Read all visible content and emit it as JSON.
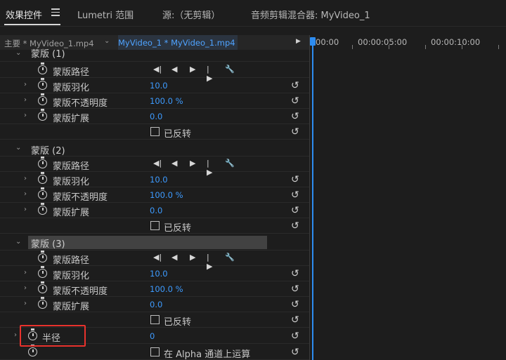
{
  "tabs": [
    {
      "label": "效果控件",
      "active": true
    },
    {
      "label": "Lumetri 范围",
      "active": false
    },
    {
      "label": "源:（无剪辑）",
      "active": false
    },
    {
      "label": "音频剪辑混合器: MyVideo_1",
      "active": false
    }
  ],
  "clip_header": {
    "master": "主要 * MyVideo_1.mp4",
    "sequence_clip": "MyVideo_1 * MyVideo_1.mp4"
  },
  "timeline": {
    "timecodes": [
      "00:00",
      "00:00:05:00",
      "00:00:10:00"
    ]
  },
  "masks": [
    {
      "name": "蒙版 (1)",
      "rows": [
        {
          "label": "蒙版路径",
          "type": "path"
        },
        {
          "label": "蒙版羽化",
          "value": "10.0"
        },
        {
          "label": "蒙版不透明度",
          "value": "100.0 %"
        },
        {
          "label": "蒙版扩展",
          "value": "0.0"
        },
        {
          "label": "已反转",
          "type": "checkbox"
        }
      ]
    },
    {
      "name": "蒙版 (2)",
      "rows": [
        {
          "label": "蒙版路径",
          "type": "path"
        },
        {
          "label": "蒙版羽化",
          "value": "10.0"
        },
        {
          "label": "蒙版不透明度",
          "value": "100.0 %"
        },
        {
          "label": "蒙版扩展",
          "value": "0.0"
        },
        {
          "label": "已反转",
          "type": "checkbox"
        }
      ]
    },
    {
      "name": "蒙版 (3)",
      "rows": [
        {
          "label": "蒙版路径",
          "type": "path"
        },
        {
          "label": "蒙版羽化",
          "value": "10.0"
        },
        {
          "label": "蒙版不透明度",
          "value": "100.0 %"
        },
        {
          "label": "蒙版扩展",
          "value": "0.0"
        },
        {
          "label": "已反转",
          "type": "checkbox"
        }
      ]
    }
  ],
  "radius": {
    "label": "半径",
    "value": "0"
  },
  "alpha_option": {
    "label": "在 Alpha 通道上运算"
  },
  "colors": {
    "accent_blue": "#3d9bff",
    "playhead": "#2d8cf0",
    "highlight_box": "#e8322c"
  }
}
